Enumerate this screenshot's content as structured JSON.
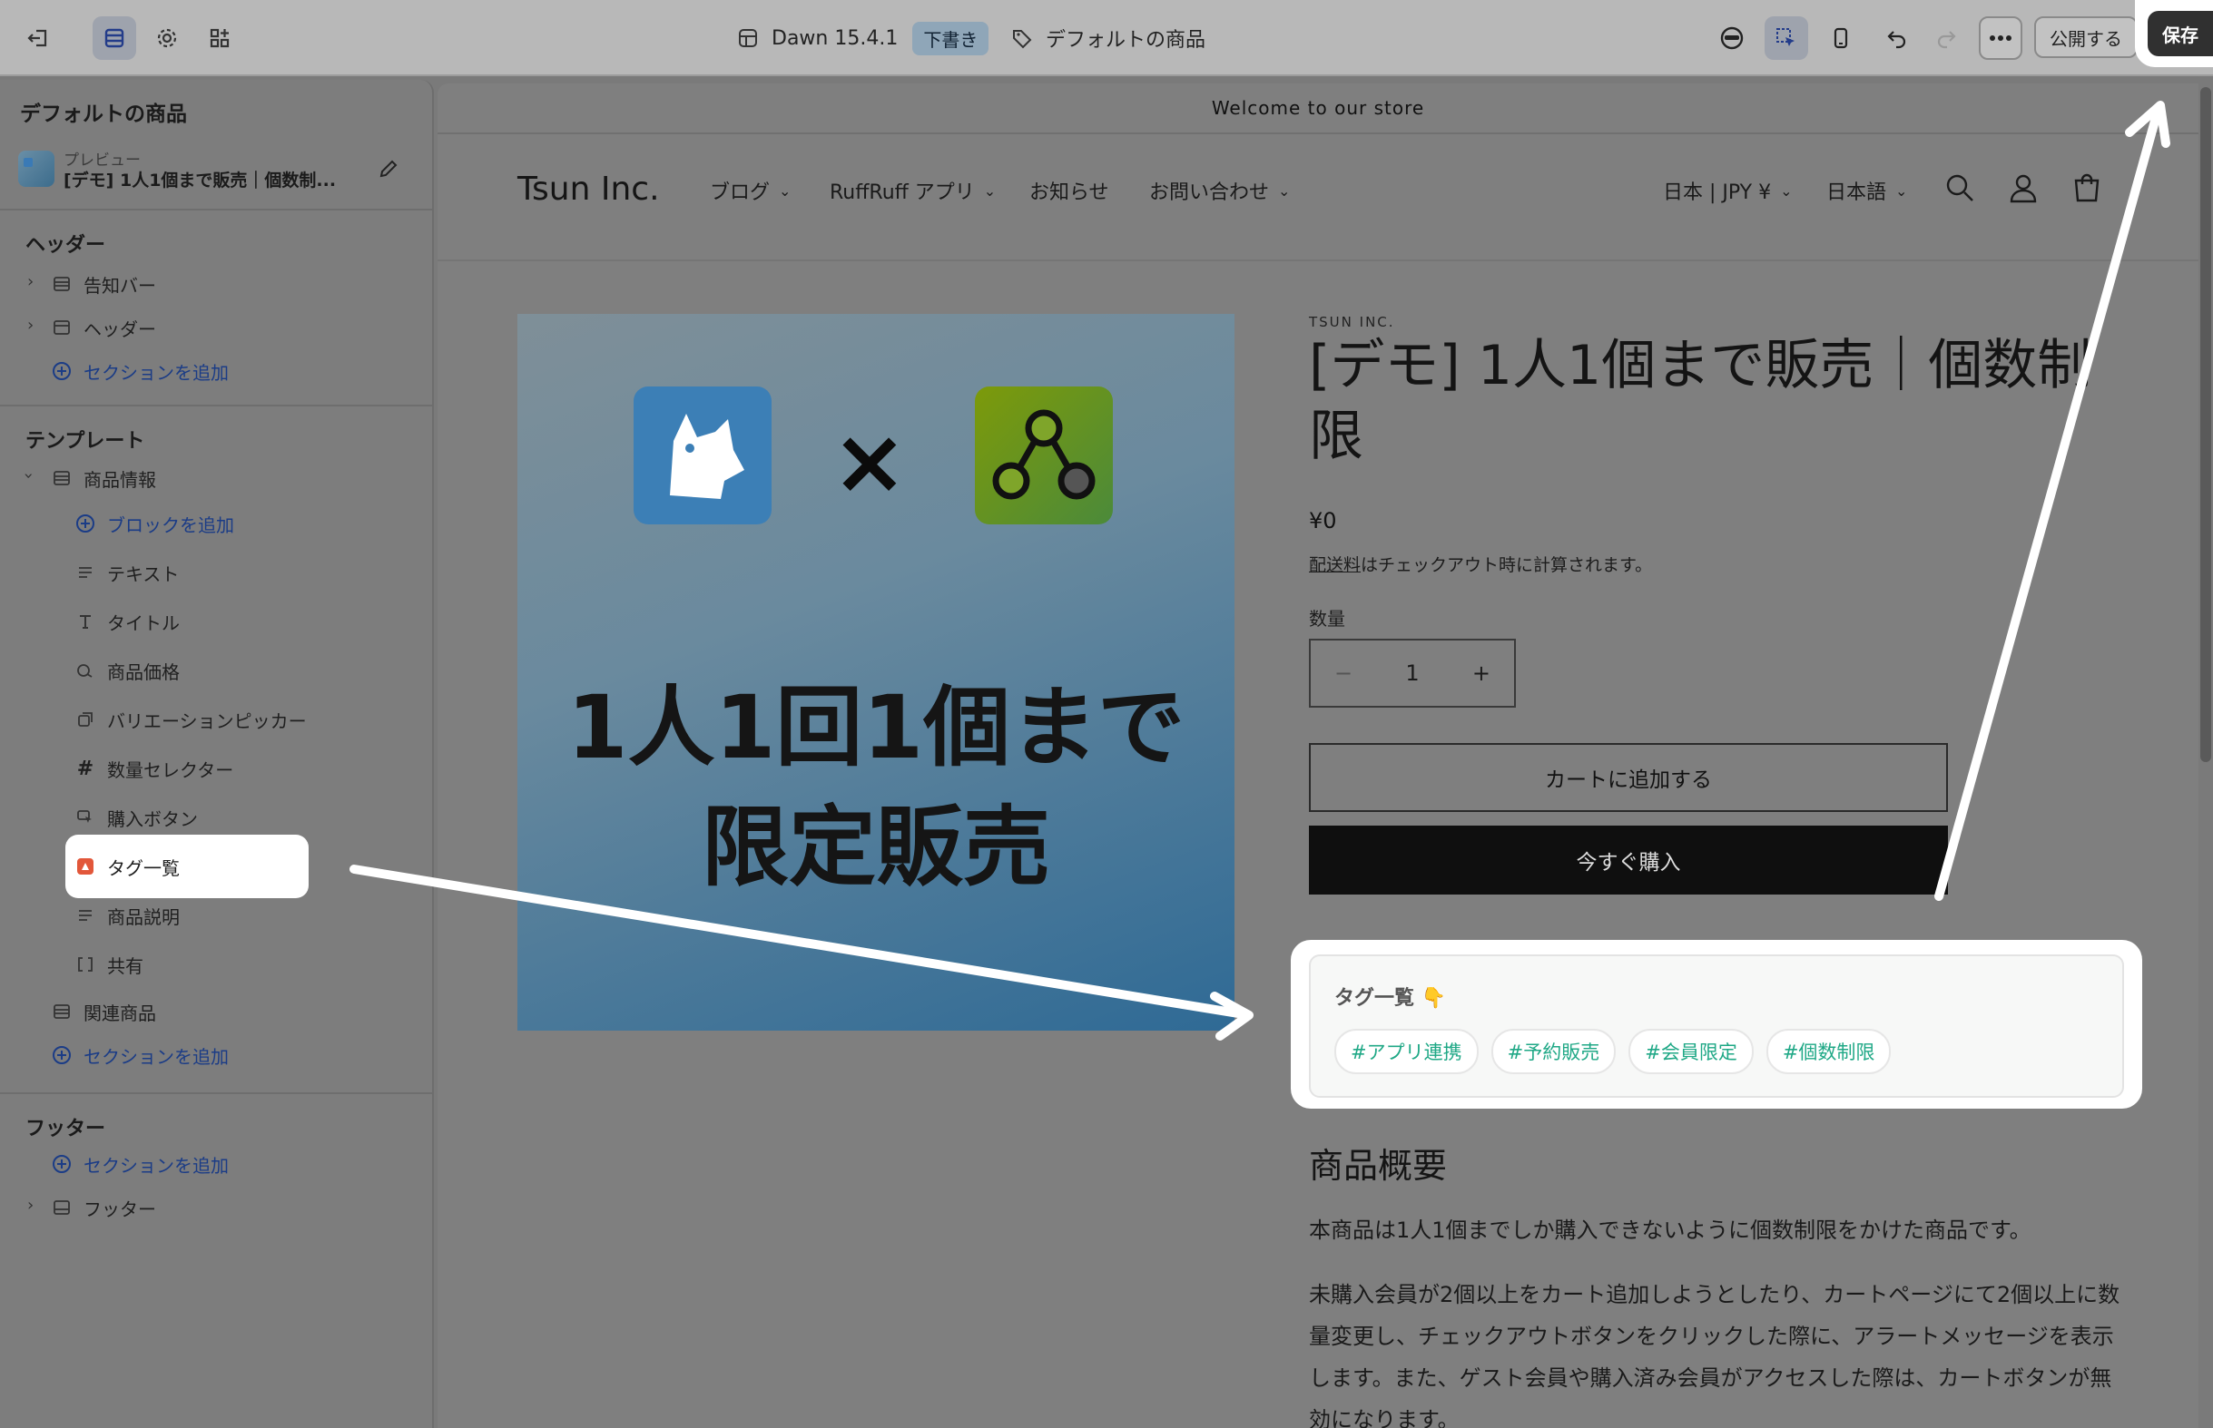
{
  "topbar": {
    "theme_name": "Dawn 15.4.1",
    "draft_badge": "下書き",
    "template_name": "デフォルトの商品",
    "publish_label": "公開する",
    "save_label": "保存"
  },
  "sidebar": {
    "title": "デフォルトの商品",
    "preview_label": "プレビュー",
    "preview_product": "[デモ] 1人1個まで販売｜個数制...",
    "header_group": {
      "title": "ヘッダー",
      "items": [
        "告知バー",
        "ヘッダー"
      ],
      "add_section": "セクションを追加"
    },
    "template_group": {
      "title": "テンプレート",
      "section": "商品情報",
      "add_block": "ブロックを追加",
      "blocks": [
        "テキスト",
        "タイトル",
        "商品価格",
        "バリエーションピッカー",
        "数量セレクター",
        "購入ボタン",
        "タグ一覧",
        "商品説明",
        "共有"
      ],
      "related": "関連商品",
      "add_section": "セクションを追加"
    },
    "footer_group": {
      "title": "フッター",
      "add_section": "セクションを追加",
      "item": "フッター"
    }
  },
  "store": {
    "announcement": "Welcome to our store",
    "logo": "Tsun Inc.",
    "nav": [
      "ブログ",
      "RuffRuff アプリ",
      "お知らせ",
      "お問い合わせ"
    ],
    "currency": "日本 | JPY ¥",
    "language": "日本語"
  },
  "product": {
    "image_text_line1": "1人1回1個まで",
    "image_text_line2": "限定販売",
    "times_symbol": "×",
    "vendor": "TSUN INC.",
    "title": "[デモ] 1人1個まで販売｜個数制限",
    "price": "¥0",
    "shipping_link": "配送料",
    "shipping_note": "はチェックアウト時に計算されます。",
    "quantity_label": "数量",
    "quantity_value": "1",
    "minus": "−",
    "plus": "+",
    "add_to_cart": "カートに追加する",
    "buy_now": "今すぐ購入",
    "tag_list_title": "タグ一覧 👇",
    "tags": [
      "#アプリ連携",
      "#予約販売",
      "#会員限定",
      "#個数制限"
    ],
    "description_title": "商品概要",
    "description_p1": "本商品は1人1個までしか購入できないように個数制限をかけた商品です。",
    "description_p2": "未購入会員が2個以上をカート追加しようとしたり、カートページにて2個以上に数量変更し、チェックアウトボタンをクリックした際に、アラートメッセージを表示します。また、ゲスト会員や購入済み会員がアクセスした際は、カートボタンが無効になります。"
  },
  "colors": {
    "tag_text": "#1fa886",
    "save_bg": "#303030",
    "link_blue": "#1b3c86"
  }
}
